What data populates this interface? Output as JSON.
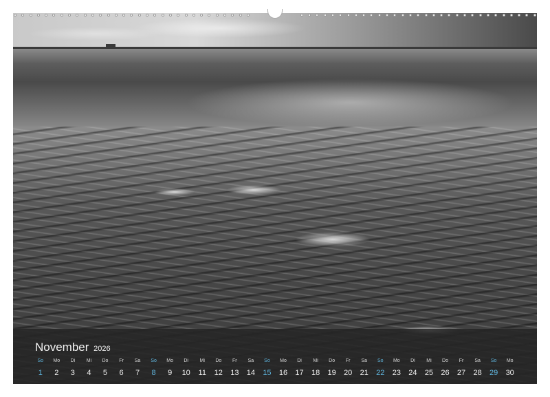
{
  "calendar": {
    "month": "November",
    "year": "2026",
    "accent_color": "#5fb4dc",
    "days": [
      {
        "wd": "So",
        "num": "1",
        "sun": true
      },
      {
        "wd": "Mo",
        "num": "2"
      },
      {
        "wd": "Di",
        "num": "3"
      },
      {
        "wd": "Mi",
        "num": "4"
      },
      {
        "wd": "Do",
        "num": "5"
      },
      {
        "wd": "Fr",
        "num": "6"
      },
      {
        "wd": "Sa",
        "num": "7"
      },
      {
        "wd": "So",
        "num": "8",
        "sun": true
      },
      {
        "wd": "Mo",
        "num": "9"
      },
      {
        "wd": "Di",
        "num": "10"
      },
      {
        "wd": "Mi",
        "num": "11"
      },
      {
        "wd": "Do",
        "num": "12"
      },
      {
        "wd": "Fr",
        "num": "13"
      },
      {
        "wd": "Sa",
        "num": "14"
      },
      {
        "wd": "So",
        "num": "15",
        "sun": true
      },
      {
        "wd": "Mo",
        "num": "16"
      },
      {
        "wd": "Di",
        "num": "17"
      },
      {
        "wd": "Mi",
        "num": "18"
      },
      {
        "wd": "Do",
        "num": "19"
      },
      {
        "wd": "Fr",
        "num": "20"
      },
      {
        "wd": "Sa",
        "num": "21"
      },
      {
        "wd": "So",
        "num": "22",
        "sun": true
      },
      {
        "wd": "Mo",
        "num": "23"
      },
      {
        "wd": "Di",
        "num": "24"
      },
      {
        "wd": "Mi",
        "num": "25"
      },
      {
        "wd": "Do",
        "num": "26"
      },
      {
        "wd": "Fr",
        "num": "27"
      },
      {
        "wd": "Sa",
        "num": "28"
      },
      {
        "wd": "So",
        "num": "29",
        "sun": true
      },
      {
        "wd": "Mo",
        "num": "30"
      }
    ]
  }
}
